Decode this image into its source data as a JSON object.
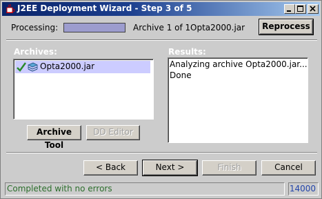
{
  "window": {
    "title": "J2EE Deployment Wizard - Step 3 of 5"
  },
  "processing": {
    "label": "Processing:",
    "progress": 1.0,
    "archive_count": "Archive 1 of 1",
    "archive_name": "Opta2000.jar",
    "reprocess_label": "Reprocess"
  },
  "archives": {
    "label": "Archives:",
    "items": [
      {
        "name": "Opta2000.jar",
        "status": "checked",
        "icon": "jar-stack-icon"
      }
    ],
    "archive_tool_label": "Archive Tool",
    "dd_editor_label": "DD Editor"
  },
  "results": {
    "label": "Results:",
    "lines": [
      "Analyzing archive Opta2000.jar...",
      "Done"
    ]
  },
  "nav": {
    "back_label": "< Back",
    "next_label": "Next >",
    "finish_label": "Finish",
    "cancel_label": "Cancel"
  },
  "status": {
    "message": "Completed with no errors",
    "port": "14000"
  },
  "colors": {
    "titlebar_start": "#0a246a",
    "titlebar_end": "#a6caf0",
    "selection": "#ccccff",
    "progress_fill": "#9c9cce",
    "status_text": "#2c6e2c",
    "status_number": "#2244aa"
  }
}
